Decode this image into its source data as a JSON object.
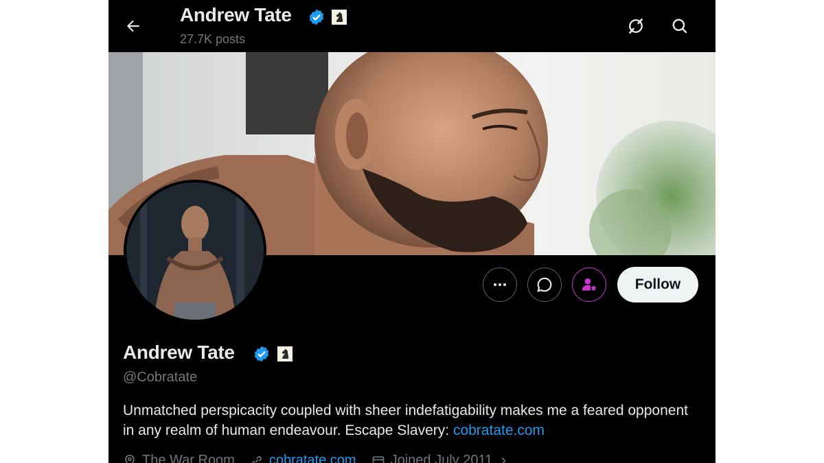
{
  "header": {
    "name": "Andrew Tate",
    "posts_count": "27.7K posts",
    "back_icon": "arrow-left-icon",
    "grok_icon": "grok-icon",
    "search_icon": "search-icon"
  },
  "profile": {
    "display_name": "Andrew Tate",
    "handle": "@Cobratate",
    "verified": true,
    "affiliate_badge": "chess-knight-badge",
    "bio_text": "Unmatched perspicacity coupled with sheer indefatigability makes me a feared opponent in any realm of human endeavour. Escape Slavery: ",
    "bio_link": "cobratate.com",
    "follow_label": "Follow",
    "more_icon": "more-icon",
    "message_icon": "message-icon",
    "subscribe_icon": "subscribe-icon",
    "meta": {
      "location": "The War Room",
      "website": "cobratate.com",
      "joined": "Joined July 2011"
    }
  },
  "colors": {
    "background": "#000000",
    "text_primary": "#e7e9ea",
    "text_secondary": "#71767b",
    "link": "#1d9bf0",
    "verified": "#1d9bf0",
    "subscribe_accent": "#c936cc",
    "follow_bg": "#eff3f4"
  }
}
